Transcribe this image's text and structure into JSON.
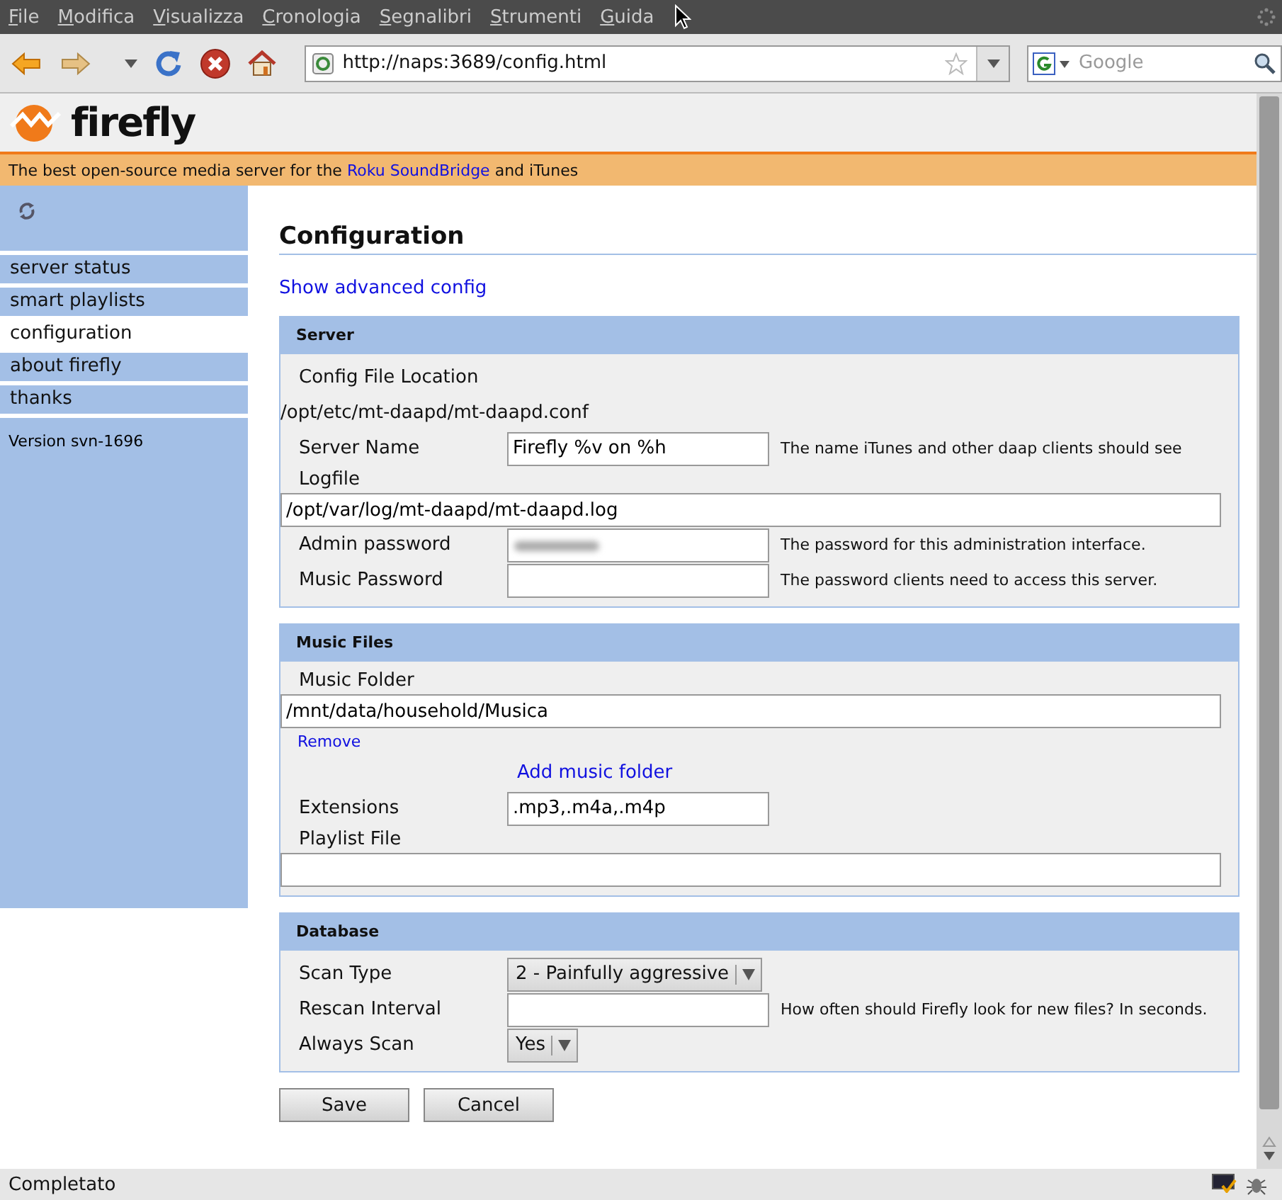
{
  "menu_bar": [
    "File",
    "Modifica",
    "Visualizza",
    "Cronologia",
    "Segnalibri",
    "Strumenti",
    "Guida"
  ],
  "toolbar": {
    "url": "http://naps:3689/config.html",
    "search": {
      "placeholder": "Google"
    }
  },
  "header": {
    "logo": "firefly",
    "tagline_before": "The best open-source media server for the ",
    "tagline_link": "Roku SoundBridge",
    "tagline_after": " and iTunes"
  },
  "sidebar": {
    "items": [
      {
        "label": "server status",
        "selected": false
      },
      {
        "label": "smart playlists",
        "selected": false
      },
      {
        "label": "configuration",
        "selected": true
      },
      {
        "label": "about firefly",
        "selected": false
      },
      {
        "label": "thanks",
        "selected": false
      }
    ],
    "version": "Version svn-1696"
  },
  "title": "Configuration",
  "advanced_link": "Show advanced config",
  "sections": [
    {
      "title": "Server",
      "rows": [
        {
          "kind": "label",
          "label": "Config File Location"
        },
        {
          "kind": "text",
          "text": "/opt/etc/mt-daapd/mt-daapd.conf"
        },
        {
          "kind": "inline",
          "label": "Server Name",
          "value": "Firefly %v on %h",
          "hint": "The name iTunes and other daap clients should see"
        },
        {
          "kind": "wide",
          "label": "Logfile",
          "value": "/opt/var/log/mt-daapd/mt-daapd.log"
        },
        {
          "kind": "inline",
          "label": "Admin password",
          "masked": true,
          "hint": "The password for this administration interface."
        },
        {
          "kind": "inline",
          "label": "Music Password",
          "masked": false,
          "hint": "The password clients need to access this server."
        }
      ]
    },
    {
      "title": "Music Files",
      "rows": [
        {
          "kind": "wide",
          "label": "Music Folder",
          "value": "/mnt/data/household/Musica"
        },
        {
          "kind": "small-link",
          "text": "Remove"
        },
        {
          "kind": "link",
          "text": "Add music folder"
        },
        {
          "kind": "inline",
          "label": "Extensions",
          "value": ".mp3,.m4a,.m4p"
        },
        {
          "kind": "wide",
          "label": "Playlist File"
        }
      ]
    },
    {
      "title": "Database",
      "rows": [
        {
          "kind": "select",
          "label": "Scan Type",
          "value": "2 - Painfully aggressive"
        },
        {
          "kind": "inline",
          "label": "Rescan Interval",
          "hint": "How often should Firefly look for new files? In seconds."
        },
        {
          "kind": "select",
          "label": "Always Scan",
          "value": "Yes"
        }
      ]
    }
  ],
  "buttons": [
    "Save",
    "Cancel"
  ],
  "status_bar": "Completato"
}
